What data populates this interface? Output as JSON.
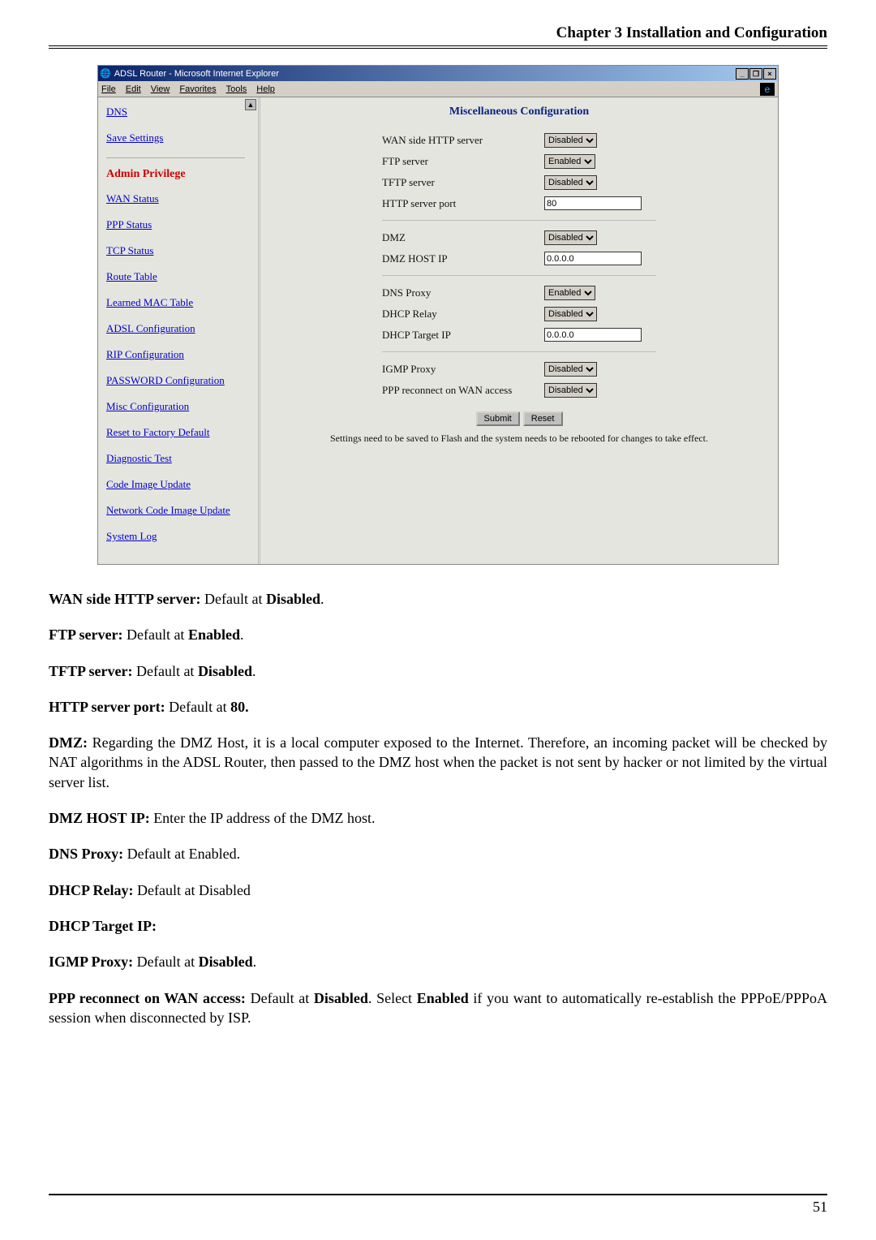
{
  "header": {
    "chapter": "Chapter 3 Installation and Configuration"
  },
  "ie_window": {
    "title": "ADSL Router - Microsoft Internet Explorer",
    "menu": [
      "File",
      "Edit",
      "View",
      "Favorites",
      "Tools",
      "Help"
    ]
  },
  "sidebar": {
    "top_links": [
      "DNS",
      "Save Settings"
    ],
    "admin_heading": "Admin Privilege",
    "links": [
      "WAN Status",
      "PPP Status",
      "TCP Status",
      "Route Table",
      "Learned MAC Table",
      "ADSL Configuration",
      "RIP Configuration",
      "PASSWORD Configuration",
      "Misc Configuration",
      "Reset to Factory Default",
      "Diagnostic Test",
      "Code Image Update",
      "Network Code Image Update",
      "System Log"
    ]
  },
  "panel": {
    "title": "Miscellaneous Configuration",
    "rows": {
      "wan_http": {
        "label": "WAN side HTTP server",
        "value": "Disabled"
      },
      "ftp": {
        "label": "FTP server",
        "value": "Enabled"
      },
      "tftp": {
        "label": "TFTP server",
        "value": "Disabled"
      },
      "http_port": {
        "label": "HTTP server port",
        "value": "80"
      },
      "dmz": {
        "label": "DMZ",
        "value": "Disabled"
      },
      "dmz_host": {
        "label": "DMZ HOST IP",
        "value": "0.0.0.0"
      },
      "dns_proxy": {
        "label": "DNS Proxy",
        "value": "Enabled"
      },
      "dhcp_relay": {
        "label": "DHCP Relay",
        "value": "Disabled"
      },
      "dhcp_target": {
        "label": "DHCP Target IP",
        "value": "0.0.0.0"
      },
      "igmp": {
        "label": "IGMP Proxy",
        "value": "Disabled"
      },
      "ppp_reconnect": {
        "label": "PPP reconnect on WAN access",
        "value": "Disabled"
      }
    },
    "buttons": {
      "submit": "Submit",
      "reset": "Reset"
    },
    "note": "Settings need to be saved to Flash and the system needs to be rebooted for changes to take effect."
  },
  "doc": {
    "p1a": "WAN side HTTP server:",
    "p1b": " Default at ",
    "p1c": "Disabled",
    "p1d": ".",
    "p2a": "FTP server:",
    "p2b": " Default at ",
    "p2c": "Enabled",
    "p2d": ".",
    "p3a": "TFTP server:",
    "p3b": " Default at ",
    "p3c": "Disabled",
    "p3d": ".",
    "p4a": "HTTP server port:",
    "p4b": " Default at ",
    "p4c": "80.",
    "p5a": "DMZ:",
    "p5b": " Regarding the DMZ Host, it is a local computer exposed to the Internet. Therefore, an incoming packet will be checked by NAT algorithms in the ADSL Router, then passed to the DMZ host when the packet is not sent by hacker or not limited by the virtual server list.",
    "p6a": "DMZ HOST IP:",
    "p6b": " Enter the IP address of the DMZ host.",
    "p7a": "DNS Proxy:",
    "p7b": " Default at Enabled.",
    "p8a": "DHCP Relay:",
    "p8b": " Default at Disabled",
    "p9a": "DHCP Target IP:",
    "p10a": "IGMP Proxy:",
    "p10b": " Default at ",
    "p10c": "Disabled",
    "p10d": ".",
    "p11a": "PPP reconnect on WAN access:",
    "p11b": " Default at ",
    "p11c": "Disabled",
    "p11d": ". Select ",
    "p11e": "Enabled",
    "p11f": " if you want to automatically re-establish the PPPoE/PPPoA session when disconnected by ISP."
  },
  "footer": {
    "page": "51"
  }
}
